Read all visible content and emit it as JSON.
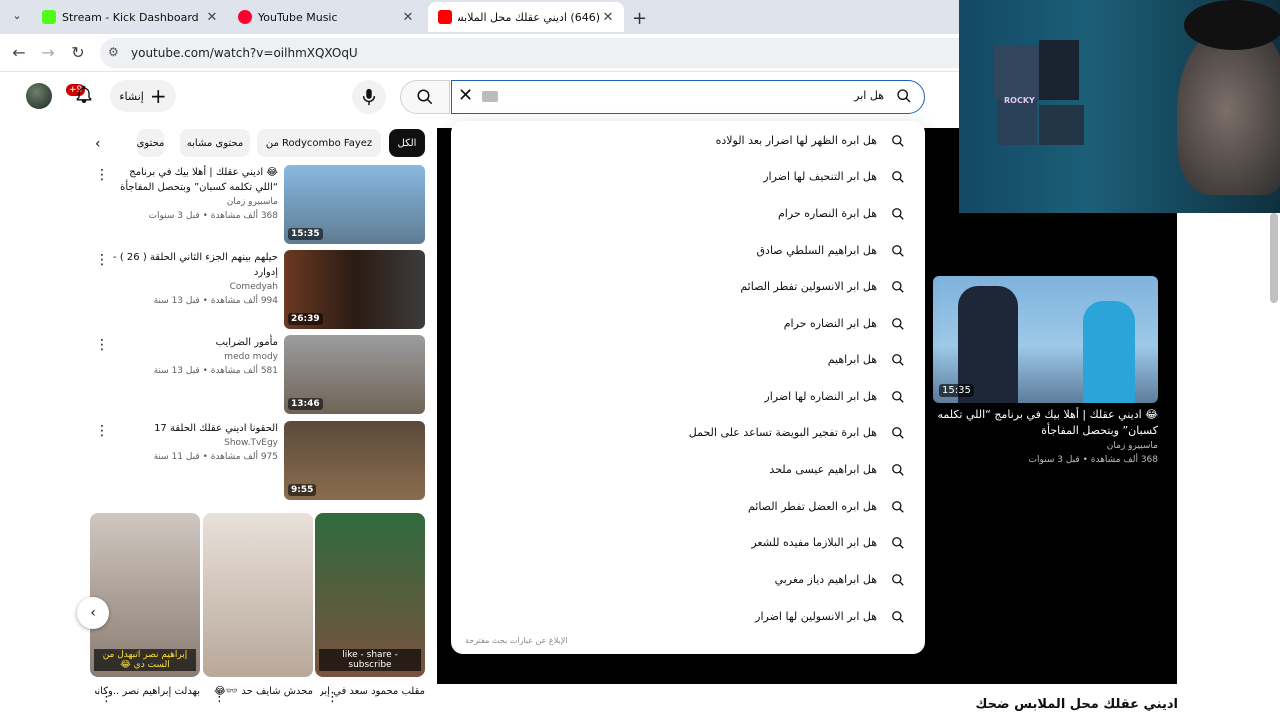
{
  "browser": {
    "tabs": [
      {
        "title": "Stream - Kick Dashboard",
        "color": "#53fc18",
        "close": "✕"
      },
      {
        "title": "YouTube Music",
        "color": "#ff0033",
        "close": "✕"
      },
      {
        "title": "(646) اديني عقلك محل الملابس ضحك",
        "color": "#ff0000",
        "close": "✕"
      }
    ],
    "new_tab": "+",
    "tab_menu": "⌄",
    "url": "youtube.com/watch?v=oilhmXQXOqU"
  },
  "header": {
    "create_label": "إنشاء",
    "notif_badge": "+9",
    "search_query": "هل ابر"
  },
  "chips": {
    "all": "الكل",
    "from": "من Rodycombo Fayez",
    "similar": "محتوى مشابه",
    "more": "محتوى"
  },
  "related": [
    {
      "title": "😂 اديني عقلك | أهلا بيك في برنامج “اللي تكلمه كسبان” وبتحصل المفاجأة",
      "channel": "ماسبيرو زمان",
      "meta": "368 ألف مشاهدة • قبل 3 سنوات",
      "duration": "15:35"
    },
    {
      "title": "حيلهم بينهم الجزء الثاني الحلقة ( 26 ) - إدوارد",
      "channel": "Comedyah",
      "meta": "994 ألف مشاهدة • قبل 13 سنة",
      "duration": "26:39"
    },
    {
      "title": "مأمور الضرايب",
      "channel": "medo mody",
      "meta": "581 ألف مشاهدة • قبل 13 سنة",
      "duration": "13:46"
    },
    {
      "title": "الحقونا اديني عقلك الحلقة 17",
      "channel": "Show.TvEgy",
      "meta": "975 ألف مشاهدة • قبل 11 سنة",
      "duration": "9:55"
    }
  ],
  "shorts": [
    {
      "title": "بهدلت إبراهيم نصر ..وكانت ...",
      "caption": "إبراهيم نصر اتبهدل من الست دي 😂"
    },
    {
      "title": "محدش شايف حد 👓😂",
      "caption": ""
    },
    {
      "title": "مقلب محمود سعد في إبراهيم نصر...",
      "caption": "like - share - subscribe"
    }
  ],
  "suggestions": [
    "هل ابره الظهر لها اضرار بعد الولاده",
    "هل ابر التنحيف لها اضرار",
    "هل ابرة النصاره حرام",
    "هل ابراهيم السلطي صادق",
    "هل ابر الانسولين تفطر الصائم",
    "هل ابر النضاره حرام",
    "هل ابراهيم",
    "هل ابر النضاره لها اضرار",
    "هل ابرة تفجير البويضة تساعد على الحمل",
    "هل ابراهيم عيسى ملحد",
    "هل ابره العضل تفطر الصائم",
    "هل ابر البلازما مفيده للشعر",
    "هل ابراهيم دياز مغربي",
    "هل ابر الانسولين لها اضرار"
  ],
  "suggestions_report": "الإبلاغ عن عبارات بحث مقترحة",
  "endscreen": {
    "title": "😂 اديني عقلك | أهلا بيك في برنامج “اللي تكلمه كسبان” وبتحصل المفاجأة",
    "channel": "ماسبيرو زمان",
    "meta": "368 ألف مشاهدة • قبل 3 سنوات",
    "duration": "15:35"
  },
  "video_title": "اديني عقلك محل الملابس ضحك",
  "webcam_poster_text": "ROCKY",
  "icons": {
    "back": "←",
    "forward": "→",
    "reload": "↻",
    "tune": "⚙",
    "clear": "✕",
    "chevron_left": "‹",
    "more": "⋮",
    "bell": "🔔",
    "plus": "+"
  },
  "colors": {
    "accent_blue": "#1c62b9",
    "youtube_red": "#ff0000",
    "kick_green": "#53fc18"
  }
}
